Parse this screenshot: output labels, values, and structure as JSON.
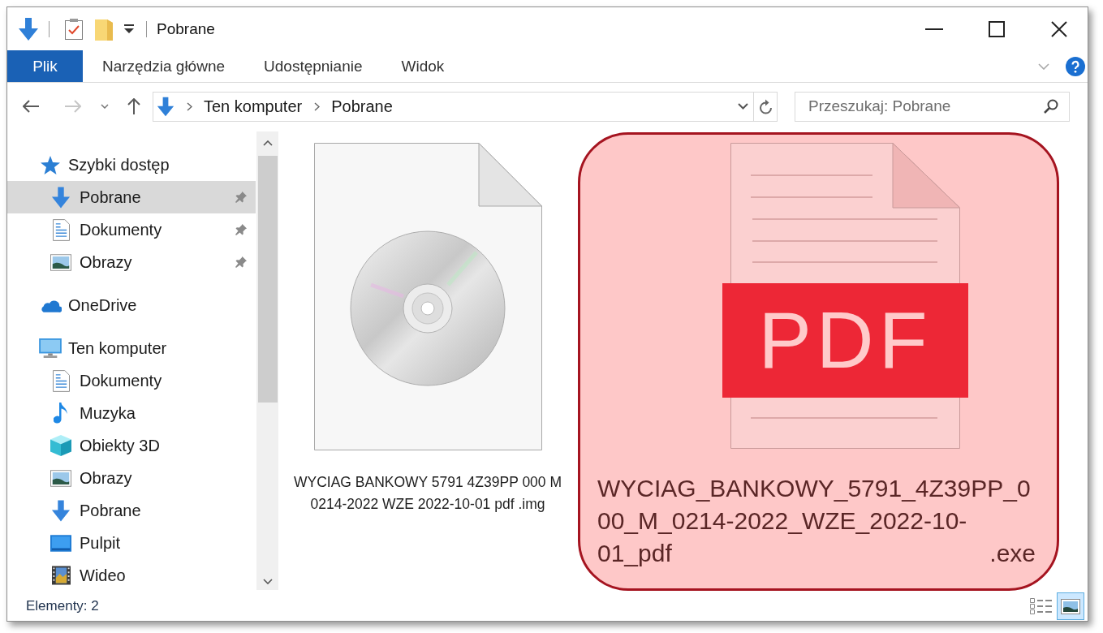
{
  "window": {
    "title": "Pobrane"
  },
  "ribbon": {
    "tabs": [
      {
        "label": "Plik",
        "kind": "file-menu"
      },
      {
        "label": "Narzędzia główne",
        "kind": "tab"
      },
      {
        "label": "Udostępnianie",
        "kind": "tab"
      },
      {
        "label": "Widok",
        "kind": "tab"
      }
    ]
  },
  "navigation": [
    {
      "kind": "back",
      "disabled": false
    },
    {
      "kind": "forward",
      "disabled": true
    },
    {
      "kind": "recent",
      "disabled": false
    },
    {
      "kind": "up",
      "disabled": false
    }
  ],
  "address_bar": {
    "path": [
      "Ten komputer",
      "Pobrane"
    ]
  },
  "search": {
    "placeholder": "Przeszukaj: Pobrane"
  },
  "sidebar": {
    "items": [
      {
        "label": "Szybki dostęp",
        "kind": "quick-access",
        "selected": false,
        "pinned": false,
        "children": [
          {
            "label": "Pobrane",
            "kind": "downloads",
            "selected": true,
            "pinned": true
          },
          {
            "label": "Dokumenty",
            "kind": "documents",
            "selected": false,
            "pinned": true
          },
          {
            "label": "Obrazy",
            "kind": "pictures",
            "selected": false,
            "pinned": true
          }
        ]
      },
      {
        "label": "OneDrive",
        "kind": "onedrive",
        "selected": false,
        "pinned": false
      },
      {
        "label": "Ten komputer",
        "kind": "computer",
        "selected": false,
        "pinned": false,
        "children": [
          {
            "label": "Dokumenty",
            "kind": "documents",
            "selected": false,
            "pinned": false
          },
          {
            "label": "Muzyka",
            "kind": "music",
            "selected": false,
            "pinned": false
          },
          {
            "label": "Obiekty 3D",
            "kind": "objects",
            "selected": false,
            "pinned": false
          },
          {
            "label": "Obrazy",
            "kind": "pictures",
            "selected": false,
            "pinned": false
          },
          {
            "label": "Pobrane",
            "kind": "downloads",
            "selected": false,
            "pinned": false
          },
          {
            "label": "Pulpit",
            "kind": "desktop",
            "selected": false,
            "pinned": false
          },
          {
            "label": "Wideo",
            "kind": "videos",
            "selected": false,
            "pinned": false
          }
        ]
      }
    ]
  },
  "files": [
    {
      "name": "WYCIAG BANKOWY 5791 4Z39PP 000 M 0214-2022 WZE 2022-10-01 pdf .img",
      "kind": "disc-image",
      "highlighted": false
    },
    {
      "name": "WYCIAG_BANKOWY_5791_4Z39PP_000_M_0214-2022_WZE_2022-10-01_pdf .exe",
      "kind": "pdf",
      "icon_label": "PDF",
      "highlighted": true
    }
  ],
  "status_bar": {
    "item_count": "Elementy: 2",
    "views": [
      {
        "kind": "details",
        "selected": false
      },
      {
        "kind": "large-icons",
        "selected": true
      }
    ]
  }
}
